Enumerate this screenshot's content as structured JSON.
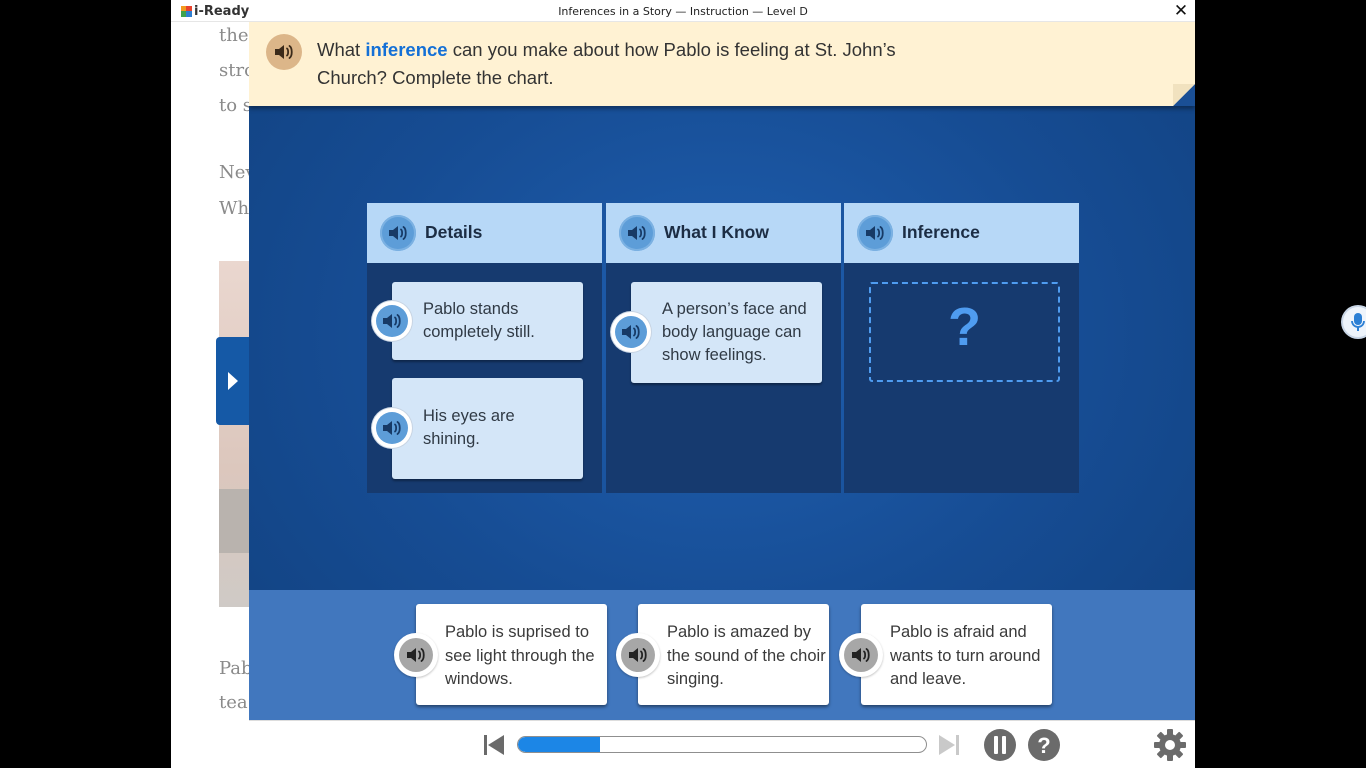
{
  "app": {
    "logo_text": "i-Ready",
    "window_title": "Inferences in a Story — Instruction — Level D",
    "close_icon": "close-icon"
  },
  "passage": {
    "lines": [
      "the",
      "stro",
      "to s",
      "Nev",
      "Wh",
      "Pab",
      "tea"
    ]
  },
  "prompt": {
    "before": "What ",
    "keyword": "inference",
    "after": " can you make about how Pablo is feeling at St. John’s Church? Complete the chart.",
    "audio_icon": "speaker-icon"
  },
  "chart": {
    "columns": [
      {
        "title": "Details"
      },
      {
        "title": "What I Know"
      },
      {
        "title": "Inference"
      }
    ],
    "details": [
      "Pablo stands completely still.",
      "His eyes are shining."
    ],
    "what_i_know": [
      "A person’s face and body language can show feelings."
    ],
    "inference_placeholder": "?"
  },
  "answers": [
    "Pablo is suprised to see light through the windows.",
    "Pablo is amazed by the sound of the choir singing.",
    "Pablo is afraid and wants to turn around and leave."
  ],
  "controls": {
    "progress_percent": 20,
    "icons": [
      "skip-back-icon",
      "skip-forward-icon",
      "pause-icon",
      "help-icon",
      "settings-icon"
    ]
  },
  "colors": {
    "stage_blue": "#164c93",
    "banner_cream": "#fff2d3",
    "keyword_blue": "#1470d6",
    "progress_blue": "#1c86e6",
    "header_light_blue": "#b7d8f7"
  }
}
